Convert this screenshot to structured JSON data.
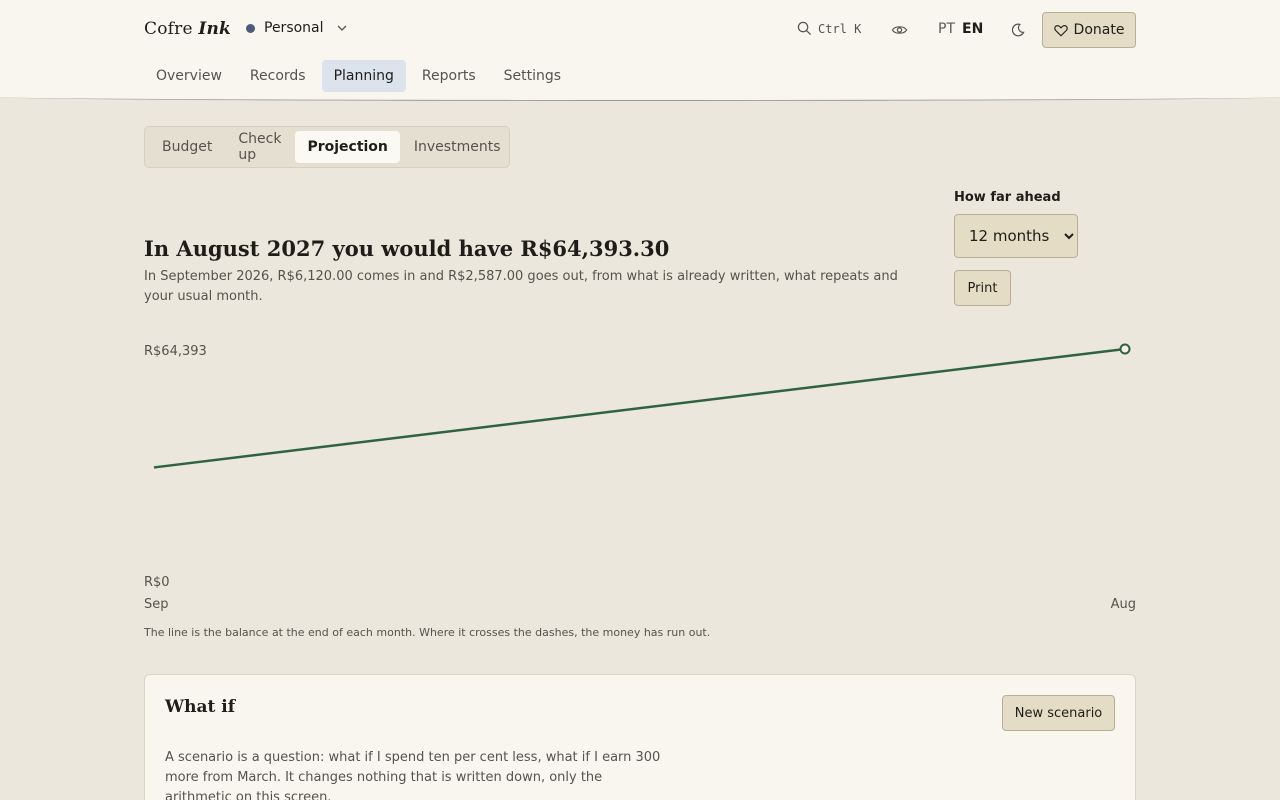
{
  "app": {
    "brand_name": "Cofre",
    "brand_suffix": "Ink",
    "workspace": "Personal",
    "search_shortcut": "Ctrl K",
    "lang_pt": "PT",
    "lang_en": "EN",
    "donate_label": "Donate"
  },
  "nav": {
    "items": [
      "Overview",
      "Records",
      "Planning",
      "Reports",
      "Settings"
    ],
    "active": "Planning"
  },
  "planning_tabs": {
    "items": [
      "Budget",
      "Check up",
      "Projection",
      "Investments"
    ],
    "active": "Projection"
  },
  "projection": {
    "headline": "In August 2027 you would have R$64,393.30",
    "summary": "In September 2026, R$6,120.00 comes in and R$2,587.00 goes out, from what is already written, what repeats and your usual month.",
    "horizon_label": "How far ahead",
    "horizon_value": "12 months",
    "horizon_options": [
      "12 months"
    ],
    "print_label": "Print",
    "caption": "The line is the balance at the end of each month. Where it crosses the dashes, the money has run out."
  },
  "chart_data": {
    "type": "line",
    "x": [
      "Sep",
      "Aug"
    ],
    "series": [
      {
        "values": [
          31380,
          64393.3
        ]
      }
    ],
    "y_top_label": "R$64,393",
    "y_bottom_label": "R$0",
    "ylim": [
      0,
      64393.3
    ],
    "x_start_label": "Sep",
    "x_end_label": "Aug",
    "line_color": "#2f6340"
  },
  "what_if": {
    "title": "What if",
    "new_scenario_label": "New scenario",
    "description": "A scenario is a question: what if I spend ten per cent less, what if I earn 300 more from March. It changes nothing that is written down, only the arithmetic on this screen."
  }
}
